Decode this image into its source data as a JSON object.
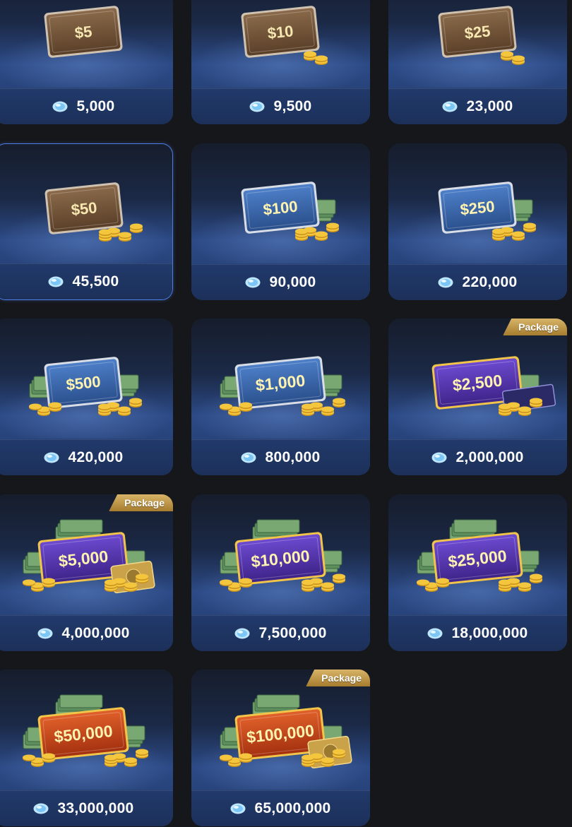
{
  "store": {
    "items": [
      {
        "label": "$5",
        "price": "5,000",
        "tier": "bronze",
        "coins": 0,
        "cash": false,
        "badge": "",
        "extra": ""
      },
      {
        "label": "$10",
        "price": "9,500",
        "tier": "bronze",
        "coins": 1,
        "cash": false,
        "badge": "",
        "extra": ""
      },
      {
        "label": "$25",
        "price": "23,000",
        "tier": "bronze",
        "coins": 1,
        "cash": false,
        "badge": "",
        "extra": ""
      },
      {
        "label": "$50",
        "price": "45,500",
        "tier": "bronze",
        "coins": 2,
        "cash": false,
        "badge": "",
        "extra": "",
        "selected": true
      },
      {
        "label": "$100",
        "price": "90,000",
        "tier": "silver",
        "coins": 2,
        "cash": true,
        "badge": "",
        "extra": ""
      },
      {
        "label": "$250",
        "price": "220,000",
        "tier": "silver",
        "coins": 2,
        "cash": true,
        "badge": "",
        "extra": ""
      },
      {
        "label": "$500",
        "price": "420,000",
        "tier": "silver",
        "coins": 3,
        "cash": true,
        "badge": "",
        "extra": ""
      },
      {
        "label": "$1,000",
        "price": "800,000",
        "tier": "silver",
        "coins": 3,
        "cash": true,
        "badge": "",
        "extra": ""
      },
      {
        "label": "$2,500",
        "price": "2,000,000",
        "tier": "purple",
        "coins": 2,
        "cash": true,
        "badge": "Package",
        "extra": "weekender"
      },
      {
        "label": "$5,000",
        "price": "4,000,000",
        "tier": "purple",
        "coins": 3,
        "cash": true,
        "badge": "Package",
        "extra": "gold-card"
      },
      {
        "label": "$10,000",
        "price": "7,500,000",
        "tier": "purple",
        "coins": 3,
        "cash": true,
        "badge": "",
        "extra": ""
      },
      {
        "label": "$25,000",
        "price": "18,000,000",
        "tier": "purple",
        "coins": 3,
        "cash": true,
        "badge": "",
        "extra": ""
      },
      {
        "label": "$50,000",
        "price": "33,000,000",
        "tier": "red",
        "coins": 3,
        "cash": true,
        "badge": "",
        "extra": ""
      },
      {
        "label": "$100,000",
        "price": "65,000,000",
        "tier": "red",
        "coins": 3,
        "cash": true,
        "badge": "Package",
        "extra": "gold-card"
      }
    ],
    "currency_icon": "diamond-gem-icon",
    "colors": {
      "bronze": "#6b4e34",
      "silver": "#3d6bb0",
      "purple": "#5b3aa8",
      "red": "#c14a1c",
      "gold": "#f2c038",
      "badge": "#c79c48",
      "selected_border": "#4c7ee6"
    }
  }
}
